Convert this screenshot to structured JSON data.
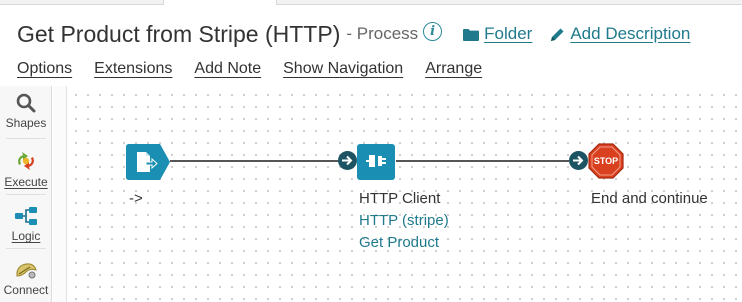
{
  "header": {
    "title": "Get Product from Stripe (HTTP)",
    "subtitle": "- Process",
    "info_icon": "info-icon",
    "folder_label": "Folder",
    "description_label": "Add Description"
  },
  "menu": {
    "items": [
      "Options",
      "Extensions",
      "Add Note",
      "Show Navigation",
      "Arrange"
    ]
  },
  "palette": {
    "items": [
      {
        "label": "Shapes",
        "icon": "search-icon"
      },
      {
        "label": "Execute",
        "icon": "execute-icon"
      },
      {
        "label": "Logic",
        "icon": "logic-icon"
      },
      {
        "label": "Connect",
        "icon": "connect-icon"
      }
    ]
  },
  "canvas": {
    "start": {
      "label": "->",
      "icon": "start-document-icon"
    },
    "http": {
      "label": "HTTP Client",
      "connection": "HTTP (stripe)",
      "operation": "Get Product",
      "icon": "connector-plug-icon"
    },
    "stop": {
      "label": "End and continue",
      "stop_text": "STOP",
      "icon": "stop-sign-icon"
    }
  },
  "colors": {
    "accent": "#1f7a8c",
    "shape_blue": "#1a8fb3",
    "stop_red": "#d8401f",
    "arrow_dark": "#1d5463"
  }
}
